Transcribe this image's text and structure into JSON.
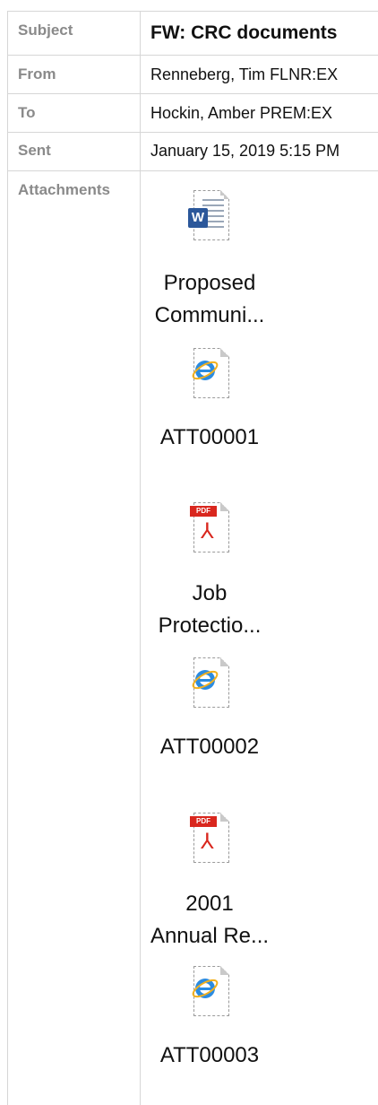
{
  "header": {
    "subject_label": "Subject",
    "subject_value": "FW: CRC documents",
    "from_label": "From",
    "from_value": "Renneberg, Tim FLNR:EX",
    "to_label": "To",
    "to_value": "Hockin, Amber PREM:EX",
    "sent_label": "Sent",
    "sent_value": "January 15, 2019 5:15 PM",
    "attachments_label": "Attachments"
  },
  "attachments": [
    {
      "name": "Proposed\nCommuni...",
      "icon": "word-doc-icon"
    },
    {
      "name": "ATT00001",
      "icon": "internet-explorer-icon"
    },
    {
      "name": "Job\nProtectio...",
      "icon": "pdf-icon"
    },
    {
      "name": "ATT00002",
      "icon": "internet-explorer-icon"
    },
    {
      "name": "2001\nAnnual Re...",
      "icon": "pdf-icon"
    },
    {
      "name": "ATT00003",
      "icon": "internet-explorer-icon"
    }
  ]
}
